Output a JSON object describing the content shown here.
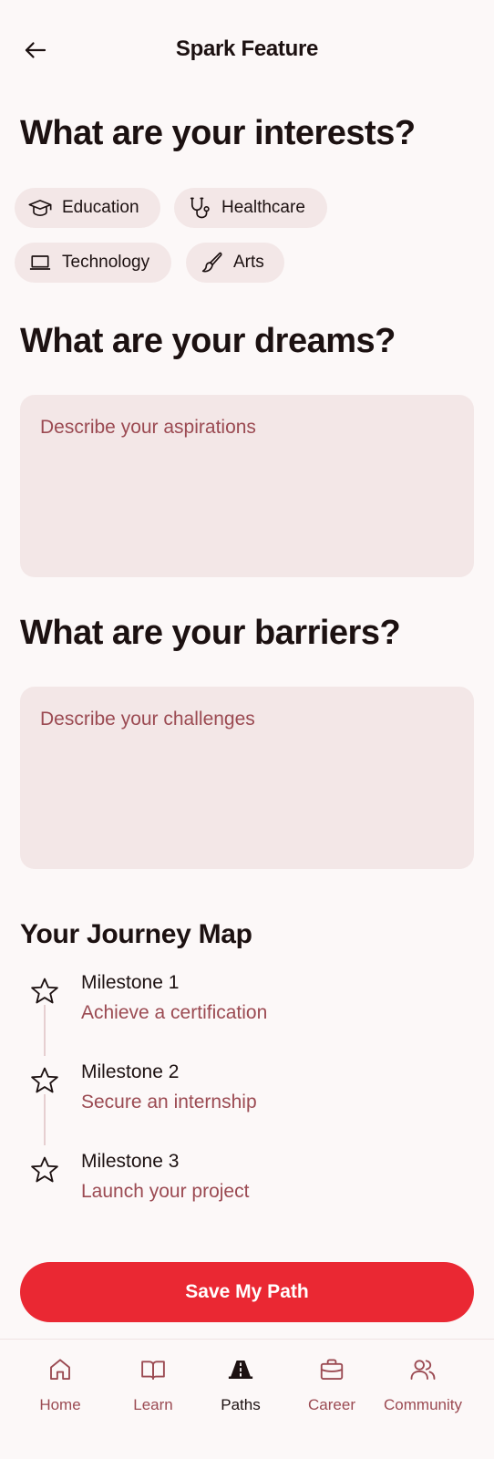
{
  "header": {
    "title": "Spark Feature",
    "back_icon": "arrow-left-icon"
  },
  "interests": {
    "title": "What are your interests?",
    "chips": [
      {
        "label": "Education",
        "icon": "graduation-cap-icon"
      },
      {
        "label": "Healthcare",
        "icon": "stethoscope-icon"
      },
      {
        "label": "Technology",
        "icon": "laptop-icon"
      },
      {
        "label": "Arts",
        "icon": "paintbrush-icon"
      }
    ]
  },
  "dreams": {
    "title": "What are your dreams?",
    "placeholder": "Describe your aspirations",
    "value": ""
  },
  "barriers": {
    "title": "What are your barriers?",
    "placeholder": "Describe your challenges",
    "value": ""
  },
  "journey": {
    "title": "Your Journey Map",
    "milestones": [
      {
        "title": "Milestone 1",
        "description": "Achieve a certification",
        "icon": "star-icon"
      },
      {
        "title": "Milestone 2",
        "description": "Secure an internship",
        "icon": "star-icon"
      },
      {
        "title": "Milestone 3",
        "description": "Launch your project",
        "icon": "star-icon"
      }
    ]
  },
  "save_button": {
    "label": "Save My Path"
  },
  "bottom_nav": {
    "items": [
      {
        "label": "Home",
        "icon": "home-icon",
        "active": false
      },
      {
        "label": "Learn",
        "icon": "book-icon",
        "active": false
      },
      {
        "label": "Paths",
        "icon": "road-icon",
        "active": true
      },
      {
        "label": "Career",
        "icon": "briefcase-icon",
        "active": false
      },
      {
        "label": "Community",
        "icon": "users-icon",
        "active": false
      }
    ]
  },
  "colors": {
    "background": "#fcf8f8",
    "field_fill": "#f3e7e7",
    "accent": "#ea2833",
    "muted_text": "#9b4a52",
    "text": "#1c1111"
  }
}
